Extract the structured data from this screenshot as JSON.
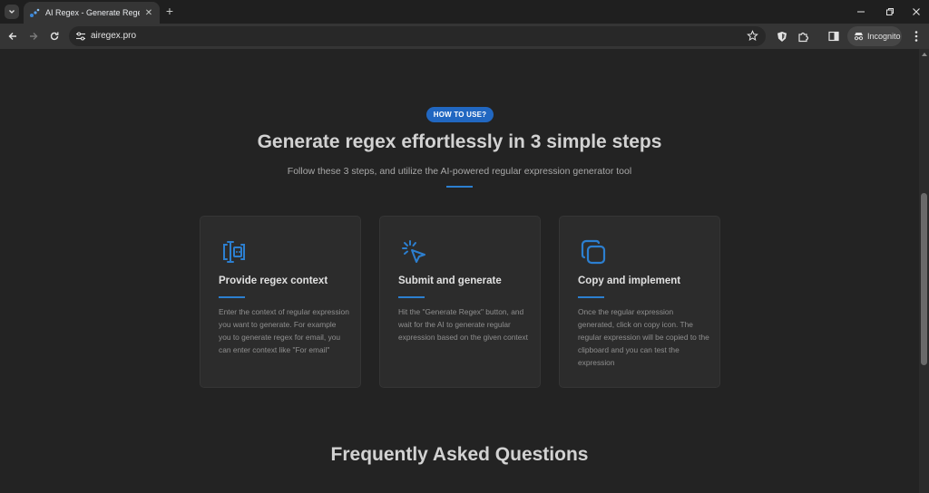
{
  "browser": {
    "tab_title": "AI Regex - Generate Regex Easily",
    "url": "airegex.pro",
    "incognito_label": "Incognito"
  },
  "how_to": {
    "badge": "HOW TO USE?",
    "title": "Generate regex effortlessly in 3 simple steps",
    "subtitle": "Follow these 3 steps, and utilize the AI-powered regular expression generator tool"
  },
  "steps": [
    {
      "icon": "context-icon",
      "title": "Provide regex context",
      "text": "Enter the context of regular expression you want to generate. For example you to generate regex for email, you can enter context like \"For email\""
    },
    {
      "icon": "click-icon",
      "title": "Submit and generate",
      "text": "Hit the \"Generate Regex\" button, and wait for the AI to generate regular expression based on the given context"
    },
    {
      "icon": "copy-icon",
      "title": "Copy and implement",
      "text": "Once the regular expression generated, click on copy icon. The regular expression will be copied to the clipboard and you can test the expression"
    }
  ],
  "faq": {
    "title": "Frequently Asked Questions"
  },
  "colors": {
    "accent": "#2c7fd0",
    "badge": "#2167c1",
    "page_bg": "#232323",
    "card_bg": "#2c2c2c"
  }
}
